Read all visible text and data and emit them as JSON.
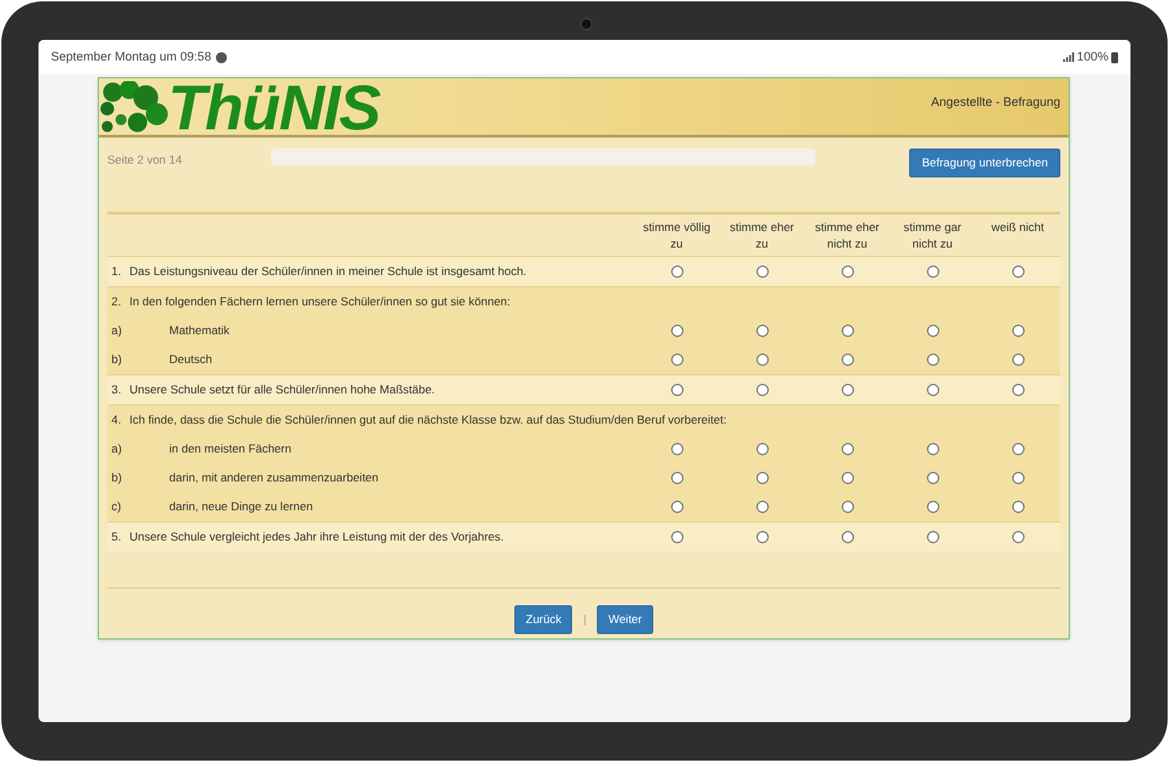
{
  "status_bar": {
    "time": "September Montag um 09:58",
    "battery": "100%"
  },
  "header": {
    "logo": "ThüNIS",
    "survey_title": "Angestellte - Befragung"
  },
  "progress": {
    "page": "Seite 2 von 14"
  },
  "pause_button": "Befragung unterbrechen",
  "columns": [
    "stimme völlig zu",
    "stimme eher zu",
    "stimme eher nicht zu",
    "stimme gar nicht zu",
    "weiß nicht"
  ],
  "questions": [
    {
      "number": "1.",
      "text": "Das Leistungsniveau der Schüler/innen in meiner Schule ist insgesamt hoch.",
      "answers": [
        {
          "selected": false
        },
        {
          "selected": false
        },
        {
          "selected": false
        },
        {
          "selected": false
        },
        {
          "selected": false
        }
      ]
    },
    {
      "number": "2.",
      "text": "In den folgenden Fächern lernen unsere Schüler/innen so gut sie können:",
      "items": [
        {
          "label": "a)",
          "text": "Mathematik",
          "answers": [
            {
              "selected": false
            },
            {
              "selected": false
            },
            {
              "selected": false
            },
            {
              "selected": false
            },
            {
              "selected": false
            }
          ]
        },
        {
          "label": "b)",
          "text": "Deutsch",
          "answers": [
            {
              "selected": false
            },
            {
              "selected": false
            },
            {
              "selected": false
            },
            {
              "selected": false
            },
            {
              "selected": false
            }
          ]
        }
      ]
    },
    {
      "number": "3.",
      "text": "Unsere Schule setzt für alle Schüler/innen hohe Maßstäbe.",
      "answers": [
        {
          "selected": false
        },
        {
          "selected": false
        },
        {
          "selected": false
        },
        {
          "selected": false
        },
        {
          "selected": false
        }
      ]
    },
    {
      "number": "4.",
      "text": "Ich finde, dass die Schule die Schüler/innen gut auf die nächste Klasse bzw. auf das Studium/den Beruf vorbereitet:",
      "items": [
        {
          "label": "a)",
          "text": "in den meisten Fächern",
          "answers": [
            {
              "selected": false
            },
            {
              "selected": false
            },
            {
              "selected": false
            },
            {
              "selected": false
            },
            {
              "selected": false
            }
          ]
        },
        {
          "label": "b)",
          "text": "darin, mit anderen zusammenzuarbeiten",
          "answers": [
            {
              "selected": false
            },
            {
              "selected": false
            },
            {
              "selected": false
            },
            {
              "selected": false
            },
            {
              "selected": false
            }
          ]
        },
        {
          "label": "c)",
          "text": "darin, neue Dinge zu lernen",
          "answers": [
            {
              "selected": false
            },
            {
              "selected": false
            },
            {
              "selected": false
            },
            {
              "selected": false
            },
            {
              "selected": false
            }
          ]
        }
      ]
    },
    {
      "number": "5.",
      "text": "Unsere Schule vergleicht jedes Jahr ihre Leistung mit der des Vorjahres.",
      "answers": [
        {
          "selected": false
        },
        {
          "selected": false
        },
        {
          "selected": false
        },
        {
          "selected": false
        },
        {
          "selected": false
        }
      ]
    }
  ],
  "nav": {
    "back": "Zurück",
    "separator": "|",
    "next": "Weiter"
  }
}
